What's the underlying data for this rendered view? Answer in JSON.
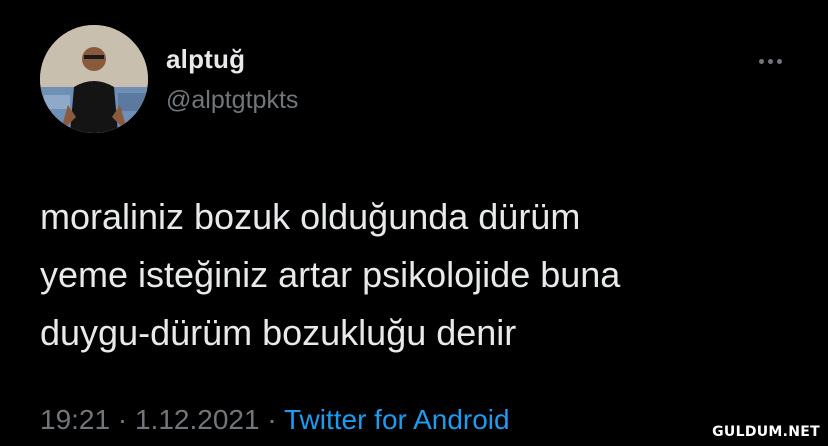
{
  "tweet": {
    "author": {
      "display_name": "alptuğ",
      "handle": "@alptgtpkts",
      "avatar_icon": "profile-photo"
    },
    "more_icon": "more-options-icon",
    "text_lines": [
      "moraliniz bozuk olduğunda dürüm",
      "yeme isteğiniz artar psikolojide buna",
      "duygu-dürüm bozukluğu denir"
    ],
    "meta": {
      "time": "19:21",
      "separator": "·",
      "date": "1.12.2021",
      "source": "Twitter for Android"
    }
  },
  "watermark": "GULDUM.NET",
  "colors": {
    "background": "#000000",
    "primary_text": "#e7e9ea",
    "secondary_text": "#71767b",
    "link": "#1d9bf0"
  }
}
